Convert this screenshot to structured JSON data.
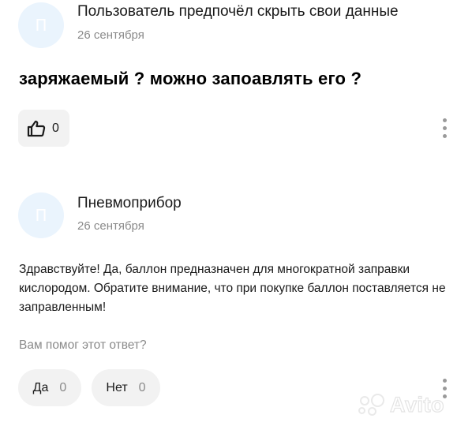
{
  "question_post": {
    "avatar_letter": "П",
    "author": "Пользователь предпочёл скрыть свои данные",
    "date": "26 сентября",
    "text": "заряжаемый ? можно запоавлять его ?",
    "likes": "0"
  },
  "answer_post": {
    "avatar_letter": "П",
    "author": "Пневмоприбор",
    "date": "26 сентября",
    "text": "Здравствуйте! Да, баллон предназначен для многократной заправки кислородом. Обратите внимание, что при покупке баллон поставляется не заправленным!",
    "helpful_prompt": "Вам помог этот ответ?",
    "yes_label": "Да",
    "yes_count": "0",
    "no_label": "Нет",
    "no_count": "0"
  },
  "watermark": "Avito",
  "colors": {
    "avatar_bg": "#eaf4fd",
    "button_bg": "#f2f2f2",
    "muted_text": "#8a8a8a"
  },
  "icons": [
    "thumbs-up-icon",
    "more-vertical-icon",
    "avito-logo"
  ]
}
